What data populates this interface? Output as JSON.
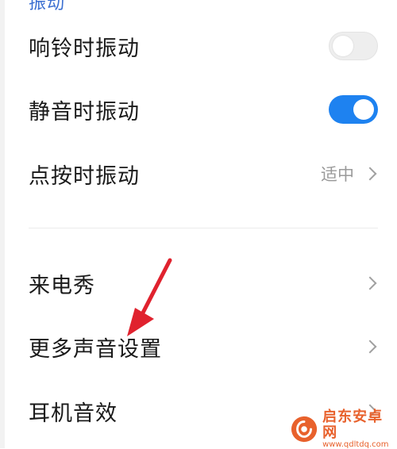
{
  "section_header": "振动",
  "rows": [
    {
      "label": "响铃时振动",
      "control": "toggle",
      "state": "off"
    },
    {
      "label": "静音时振动",
      "control": "toggle",
      "state": "on"
    },
    {
      "label": "点按时振动",
      "value": "适中",
      "control": "chevron"
    },
    {
      "label": "来电秀",
      "control": "chevron"
    },
    {
      "label": "更多声音设置",
      "control": "chevron"
    },
    {
      "label": "耳机音效",
      "control": "chevron"
    }
  ],
  "colors": {
    "accent": "#1e82f0",
    "annotation_arrow": "#e0222e",
    "watermark": "#e8612c"
  },
  "watermark": {
    "name": "启东安卓网",
    "url": "www.qdltdq.com"
  }
}
